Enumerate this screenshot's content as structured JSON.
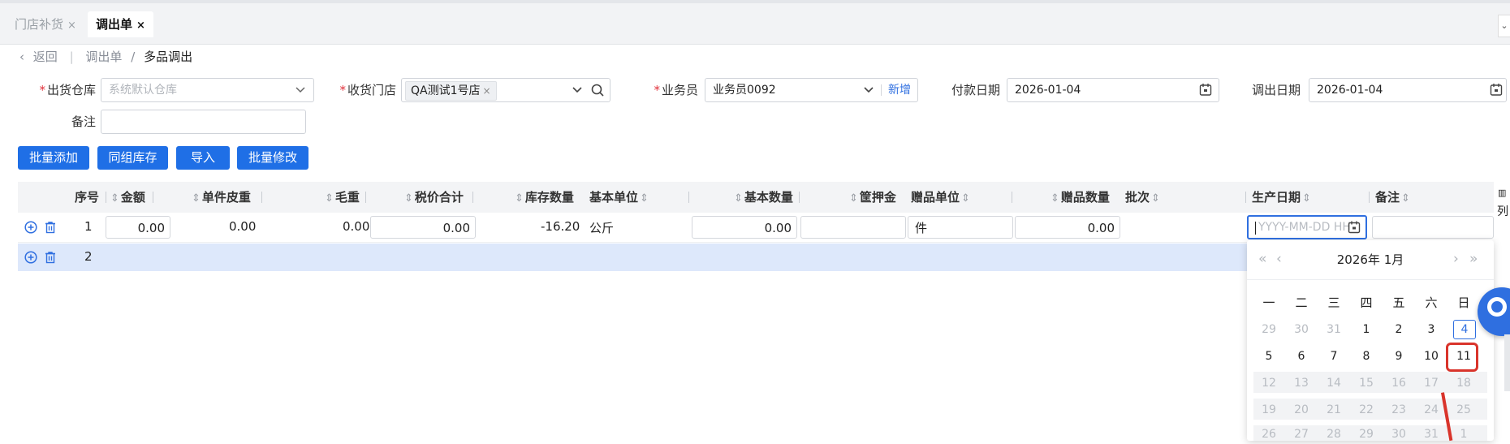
{
  "tabs": [
    {
      "label": "门店补货",
      "close": "×",
      "active": false
    },
    {
      "label": "调出单",
      "close": "×",
      "active": true
    }
  ],
  "breadcrumb": {
    "back": "返回",
    "parent": "调出单",
    "separator": "/",
    "current": "多品调出"
  },
  "form": {
    "out_warehouse": {
      "label": "出货仓库",
      "placeholder": "系统默认仓库"
    },
    "receive_store": {
      "label": "收货门店",
      "tag": "QA测试1号店",
      "tag_close": "×"
    },
    "salesman": {
      "label": "业务员",
      "value": "业务员0092",
      "add_link": "新增"
    },
    "pay_date": {
      "label": "付款日期",
      "value": "2026-01-04"
    },
    "out_date": {
      "label": "调出日期",
      "value": "2026-01-04"
    },
    "remark": {
      "label": "备注",
      "value": ""
    }
  },
  "buttons": [
    "批量添加",
    "同组库存",
    "导入",
    "批量修改"
  ],
  "table": {
    "headers": [
      "序号",
      "金额",
      "单件皮重",
      "毛重",
      "税价合计",
      "库存数量",
      "基本单位",
      "基本数量",
      "筐押金",
      "赠品单位",
      "赠品数量",
      "批次",
      "生产日期",
      "备注"
    ],
    "rows": [
      {
        "index": "1",
        "amount": "0.00",
        "tare": "0.00",
        "gross": "0.00",
        "tax_total": "0.00",
        "stock": "-16.20",
        "base_unit": "公斤",
        "base_qty": "0.00",
        "deposit": "",
        "gift_unit": "件",
        "gift_qty": "0.00",
        "batch": "",
        "prod_date_placeholder": "YYYY-MM-DD HH",
        "remark": ""
      },
      {
        "index": "2"
      }
    ]
  },
  "calendar": {
    "prev_year": "«",
    "prev_month": "‹",
    "title": "2026年 1月",
    "next_month": "›",
    "next_year": "»",
    "weekdays": [
      "一",
      "二",
      "三",
      "四",
      "五",
      "六",
      "日"
    ],
    "weeks": [
      [
        "29",
        "30",
        "31",
        "1",
        "2",
        "3",
        "4"
      ],
      [
        "5",
        "6",
        "7",
        "8",
        "9",
        "10",
        "11"
      ],
      [
        "12",
        "13",
        "14",
        "15",
        "16",
        "17",
        "18"
      ],
      [
        "19",
        "20",
        "21",
        "22",
        "23",
        "24",
        "25"
      ],
      [
        "26",
        "27",
        "28",
        "29",
        "30",
        "31",
        "1"
      ]
    ],
    "today": "4",
    "highlighted": "11"
  },
  "side_panel": {
    "label": "列"
  },
  "colors": {
    "accent": "#1f6fe6",
    "required": "#e0303a",
    "annotation": "#d9342b",
    "row_selected": "#dde8fb"
  },
  "icons": [
    "close-icon",
    "back-chevron-icon",
    "chevron-down-icon",
    "search-icon",
    "calendar-icon",
    "add-circle-icon",
    "trash-icon",
    "sort-icon",
    "column-settings-icon",
    "assistant-icon"
  ]
}
